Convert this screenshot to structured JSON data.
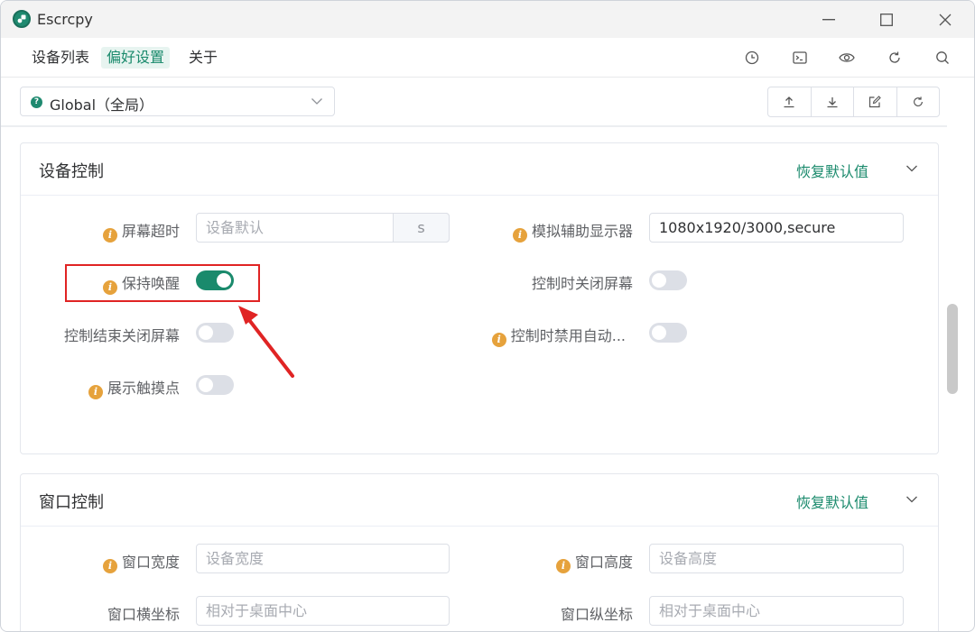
{
  "window": {
    "title": "Escrcpy",
    "controls": [
      "minimize-icon",
      "maximize-icon",
      "close-icon"
    ]
  },
  "menubar": {
    "items": [
      {
        "label": "设备列表",
        "active": false
      },
      {
        "label": "偏好设置",
        "active": true
      },
      {
        "label": "关于",
        "active": false
      }
    ],
    "tools": [
      "clock-icon",
      "terminal-icon",
      "eye-icon",
      "refresh-icon",
      "search-icon"
    ]
  },
  "scope_select": {
    "badge": "?",
    "value": "Global（全局）"
  },
  "scope_actions": [
    "upload-icon",
    "download-icon",
    "edit-icon",
    "refresh-icon"
  ],
  "device_control": {
    "title": "设备控制",
    "reset_label": "恢复默认值",
    "screen_timeout": {
      "label": "屏幕超时",
      "placeholder": "设备默认",
      "unit": "s"
    },
    "virtual_display": {
      "label": "模拟辅助显示器",
      "value": "1080x1920/3000,secure"
    },
    "stay_awake": {
      "label": "保持唤醒",
      "on": true
    },
    "turn_off_screen_on_control": {
      "label": "控制时关闭屏幕",
      "on": false
    },
    "turn_off_screen_on_exit": {
      "label": "控制结束关闭屏幕",
      "on": false
    },
    "disable_auto_on_control": {
      "label": "控制时禁用自动...",
      "on": false
    },
    "show_touches": {
      "label": "展示触摸点",
      "on": false
    }
  },
  "window_control": {
    "title": "窗口控制",
    "reset_label": "恢复默认值",
    "window_width": {
      "label": "窗口宽度",
      "placeholder": "设备宽度"
    },
    "window_height": {
      "label": "窗口高度",
      "placeholder": "设备高度"
    },
    "window_x": {
      "label": "窗口横坐标",
      "placeholder": "相对于桌面中心"
    },
    "window_y": {
      "label": "窗口纵坐标",
      "placeholder": "相对于桌面中心"
    }
  },
  "colors": {
    "accent": "#1a8a6c",
    "info": "#e6a23c",
    "highlight": "#e02424"
  }
}
